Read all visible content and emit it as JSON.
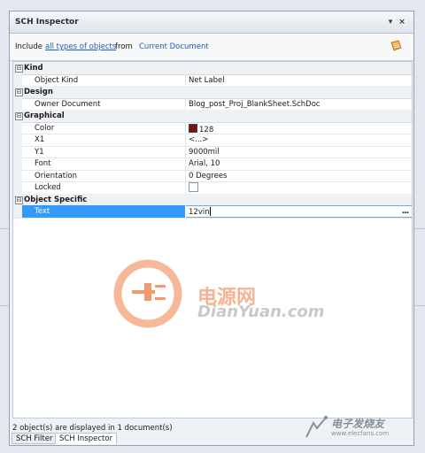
{
  "panel": {
    "title": "SCH Inspector",
    "buttons": {
      "dropdown": "▾",
      "pin": "⊕",
      "close": "×"
    }
  },
  "include": {
    "prefix": "Include",
    "objects_link": "all types of objects",
    "from": "from",
    "scope_link": "Current Document"
  },
  "categories": [
    {
      "label": "Kind",
      "toggle": "⊟"
    },
    {
      "label": "Design",
      "toggle": "⊟"
    },
    {
      "label": "Graphical",
      "toggle": "⊟"
    },
    {
      "label": "Object Specific",
      "toggle": "⊟"
    }
  ],
  "properties": {
    "object_kind": {
      "name": "Object Kind",
      "value": "Net Label"
    },
    "owner_document": {
      "name": "Owner Document",
      "value": "Blog_post_Proj_BlankSheet.SchDoc"
    },
    "color": {
      "name": "Color",
      "value": "128",
      "swatch": "#7a1212"
    },
    "x1": {
      "name": "X1",
      "value": "<...>"
    },
    "y1": {
      "name": "Y1",
      "value": "9000mil"
    },
    "font": {
      "name": "Font",
      "value": "Arial, 10"
    },
    "orientation": {
      "name": "Orientation",
      "value": "0 Degrees"
    },
    "locked": {
      "name": "Locked",
      "checked": false
    },
    "text": {
      "name": "Text",
      "value": "12vin",
      "ellipsis": "..."
    }
  },
  "watermark": {
    "cn": "电源网",
    "en": "DianYuan.com",
    "corner": "电子发烧友",
    "corner_sub": "www.elecfans.com"
  },
  "status": "2 object(s) are displayed in 1 document(s)",
  "tabs": [
    {
      "label": "SCH Filter",
      "active": false
    },
    {
      "label": "SCH Inspector",
      "active": true
    }
  ],
  "colors": {
    "selection": "#3399ff",
    "link": "#1f5fb0",
    "watermark_orange": "#f39a6d"
  }
}
